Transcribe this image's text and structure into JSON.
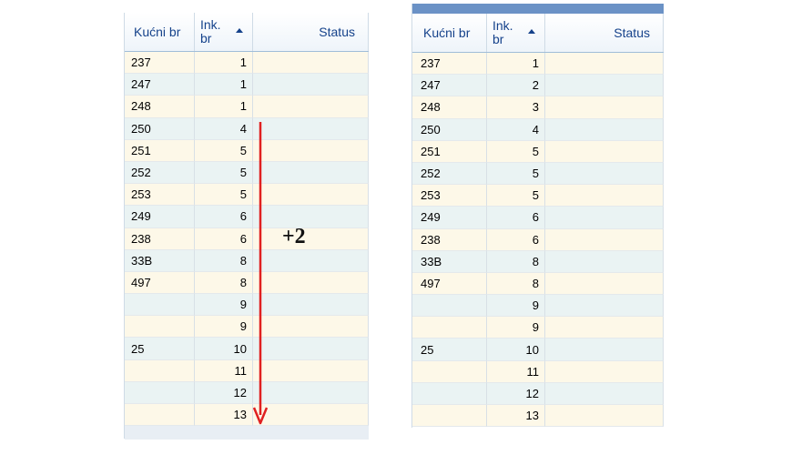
{
  "left_grid": {
    "columns": [
      "Kućni br",
      "Ink.\nbr",
      "Status"
    ],
    "rows": [
      {
        "kucni_br": "237",
        "ink_br": "1",
        "status": ""
      },
      {
        "kucni_br": "247",
        "ink_br": "1",
        "status": ""
      },
      {
        "kucni_br": "248",
        "ink_br": "1",
        "status": ""
      },
      {
        "kucni_br": "250",
        "ink_br": "4",
        "status": ""
      },
      {
        "kucni_br": "251",
        "ink_br": "5",
        "status": ""
      },
      {
        "kucni_br": "252",
        "ink_br": "5",
        "status": ""
      },
      {
        "kucni_br": "253",
        "ink_br": "5",
        "status": ""
      },
      {
        "kucni_br": "249",
        "ink_br": "6",
        "status": ""
      },
      {
        "kucni_br": "238",
        "ink_br": "6",
        "status": ""
      },
      {
        "kucni_br": "33B",
        "ink_br": "8",
        "status": ""
      },
      {
        "kucni_br": "497",
        "ink_br": "8",
        "status": ""
      },
      {
        "kucni_br": "",
        "ink_br": "9",
        "status": ""
      },
      {
        "kucni_br": "",
        "ink_br": "9",
        "status": ""
      },
      {
        "kucni_br": "25",
        "ink_br": "10",
        "status": ""
      },
      {
        "kucni_br": "",
        "ink_br": "11",
        "status": ""
      },
      {
        "kucni_br": "",
        "ink_br": "12",
        "status": ""
      },
      {
        "kucni_br": "",
        "ink_br": "13",
        "status": ""
      }
    ]
  },
  "right_grid": {
    "columns": [
      "Kućni br",
      "Ink.\nbr",
      "Status"
    ],
    "rows": [
      {
        "kucni_br": "237",
        "ink_br": "1",
        "status": ""
      },
      {
        "kucni_br": "247",
        "ink_br": "2",
        "status": ""
      },
      {
        "kucni_br": "248",
        "ink_br": "3",
        "status": ""
      },
      {
        "kucni_br": "250",
        "ink_br": "4",
        "status": ""
      },
      {
        "kucni_br": "251",
        "ink_br": "5",
        "status": ""
      },
      {
        "kucni_br": "252",
        "ink_br": "5",
        "status": ""
      },
      {
        "kucni_br": "253",
        "ink_br": "5",
        "status": ""
      },
      {
        "kucni_br": "249",
        "ink_br": "6",
        "status": ""
      },
      {
        "kucni_br": "238",
        "ink_br": "6",
        "status": ""
      },
      {
        "kucni_br": "33B",
        "ink_br": "8",
        "status": ""
      },
      {
        "kucni_br": "497",
        "ink_br": "8",
        "status": ""
      },
      {
        "kucni_br": "",
        "ink_br": "9",
        "status": ""
      },
      {
        "kucni_br": "",
        "ink_br": "9",
        "status": ""
      },
      {
        "kucni_br": "25",
        "ink_br": "10",
        "status": ""
      },
      {
        "kucni_br": "",
        "ink_br": "11",
        "status": ""
      },
      {
        "kucni_br": "",
        "ink_br": "12",
        "status": ""
      },
      {
        "kucni_br": "",
        "ink_br": "13",
        "status": ""
      }
    ]
  },
  "annotation": {
    "label": "+2",
    "arrow_color": "#e02020"
  },
  "colors": {
    "header_text": "#15428b",
    "row_odd": "#fdf8e8",
    "row_even": "#eaf3f3",
    "title_bar": "#6b92c6"
  }
}
